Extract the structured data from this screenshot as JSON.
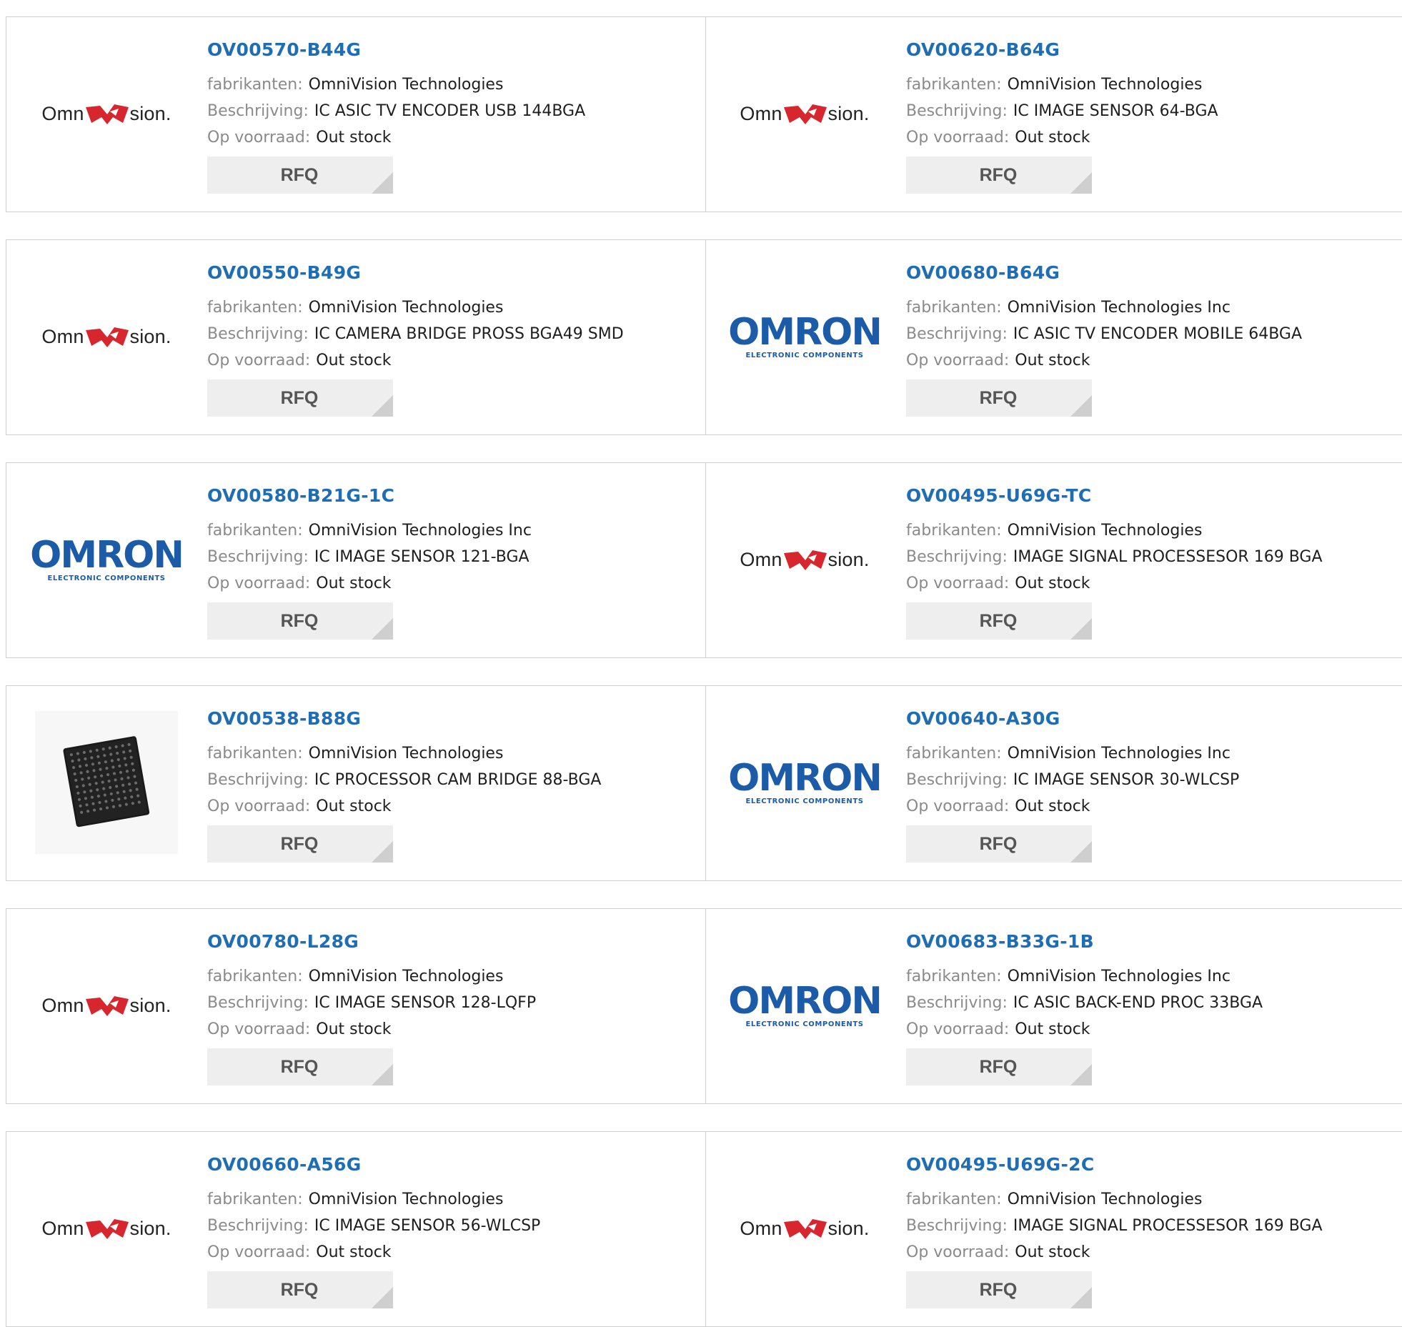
{
  "labels": {
    "manufacturer": "fabrikanten:",
    "description": "Beschrijving:",
    "stock": "Op voorraad:",
    "rfq": "RFQ"
  },
  "logos": {
    "omnivision": {
      "left_text": "Omn",
      "right_text": "sion",
      "dot": "."
    },
    "omron": {
      "word": "OMRON",
      "sub": "ELECTRONIC COMPONENTS"
    }
  },
  "colors": {
    "part_link": "#1f6eb5",
    "label_gray": "#8a8a8a",
    "rfq_bg": "#eeeeee",
    "omnivision_red": "#d8262f",
    "omron_blue": "#1b5ba8"
  },
  "products": [
    {
      "part": "OV00570-B44G",
      "manufacturer": "OmniVision Technologies",
      "description": "IC ASIC TV ENCODER USB 144BGA",
      "stock": "Out stock",
      "logo": "omnivision"
    },
    {
      "part": "OV00620-B64G",
      "manufacturer": "OmniVision Technologies",
      "description": "IC IMAGE SENSOR 64-BGA",
      "stock": "Out stock",
      "logo": "omnivision"
    },
    {
      "part": "OV00550-B49G",
      "manufacturer": "OmniVision Technologies",
      "description": "IC CAMERA BRIDGE PROSS BGA49 SMD",
      "stock": "Out stock",
      "logo": "omnivision"
    },
    {
      "part": "OV00680-B64G",
      "manufacturer": "OmniVision Technologies Inc",
      "description": "IC ASIC TV ENCODER MOBILE 64BGA",
      "stock": "Out stock",
      "logo": "omron"
    },
    {
      "part": "OV00580-B21G-1C",
      "manufacturer": "OmniVision Technologies Inc",
      "description": "IC IMAGE SENSOR 121-BGA",
      "stock": "Out stock",
      "logo": "omron"
    },
    {
      "part": "OV00495-U69G-TC",
      "manufacturer": "OmniVision Technologies",
      "description": "IMAGE SIGNAL PROCESSESOR 169 BGA",
      "stock": "Out stock",
      "logo": "omnivision"
    },
    {
      "part": "OV00538-B88G",
      "manufacturer": "OmniVision Technologies",
      "description": "IC PROCESSOR CAM BRIDGE 88-BGA",
      "stock": "Out stock",
      "logo": "chip"
    },
    {
      "part": "OV00640-A30G",
      "manufacturer": "OmniVision Technologies Inc",
      "description": "IC IMAGE SENSOR 30-WLCSP",
      "stock": "Out stock",
      "logo": "omron"
    },
    {
      "part": "OV00780-L28G",
      "manufacturer": "OmniVision Technologies",
      "description": "IC IMAGE SENSOR 128-LQFP",
      "stock": "Out stock",
      "logo": "omnivision"
    },
    {
      "part": "OV00683-B33G-1B",
      "manufacturer": "OmniVision Technologies Inc",
      "description": "IC ASIC BACK-END PROC 33BGA",
      "stock": "Out stock",
      "logo": "omron"
    },
    {
      "part": "OV00660-A56G",
      "manufacturer": "OmniVision Technologies",
      "description": "IC IMAGE SENSOR 56-WLCSP",
      "stock": "Out stock",
      "logo": "omnivision"
    },
    {
      "part": "OV00495-U69G-2C",
      "manufacturer": "OmniVision Technologies",
      "description": "IMAGE SIGNAL PROCESSESOR 169 BGA",
      "stock": "Out stock",
      "logo": "omnivision"
    }
  ]
}
